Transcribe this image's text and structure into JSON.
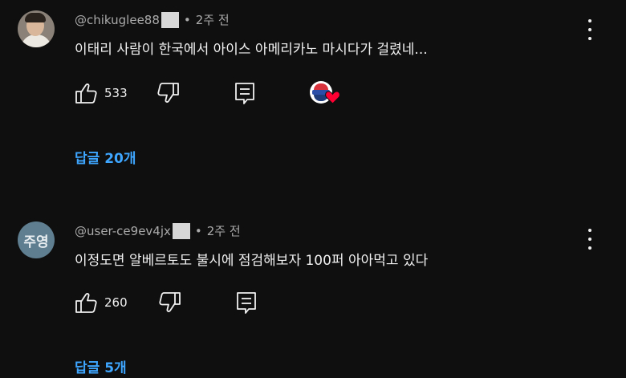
{
  "comments": [
    {
      "handle": "@chikuglee88",
      "time": "2주 전",
      "text": "이태리 사람이 한국에서 아이스 아메리카노 마시다가 걸렸네...",
      "likes": "533",
      "replies": "답글 20개",
      "avatar": "photo"
    },
    {
      "handle": "@user-ce9ev4jx",
      "time": "2주 전",
      "text": "이정도면 알베르토도 불시에 점검해보자 100퍼 아아먹고 있다",
      "likes": "260",
      "replies": "답글 5개",
      "avatar_initials": "주영"
    }
  ],
  "colors": {
    "background": "#0f0f0f",
    "reply_link": "#3ea6ff",
    "heart": "#ff0033",
    "initials_avatar": "#5f7f91"
  },
  "icons": [
    "thumb-up-icon",
    "thumb-down-icon",
    "reply-icon",
    "more-vert-icon",
    "creator-heart-icon"
  ]
}
